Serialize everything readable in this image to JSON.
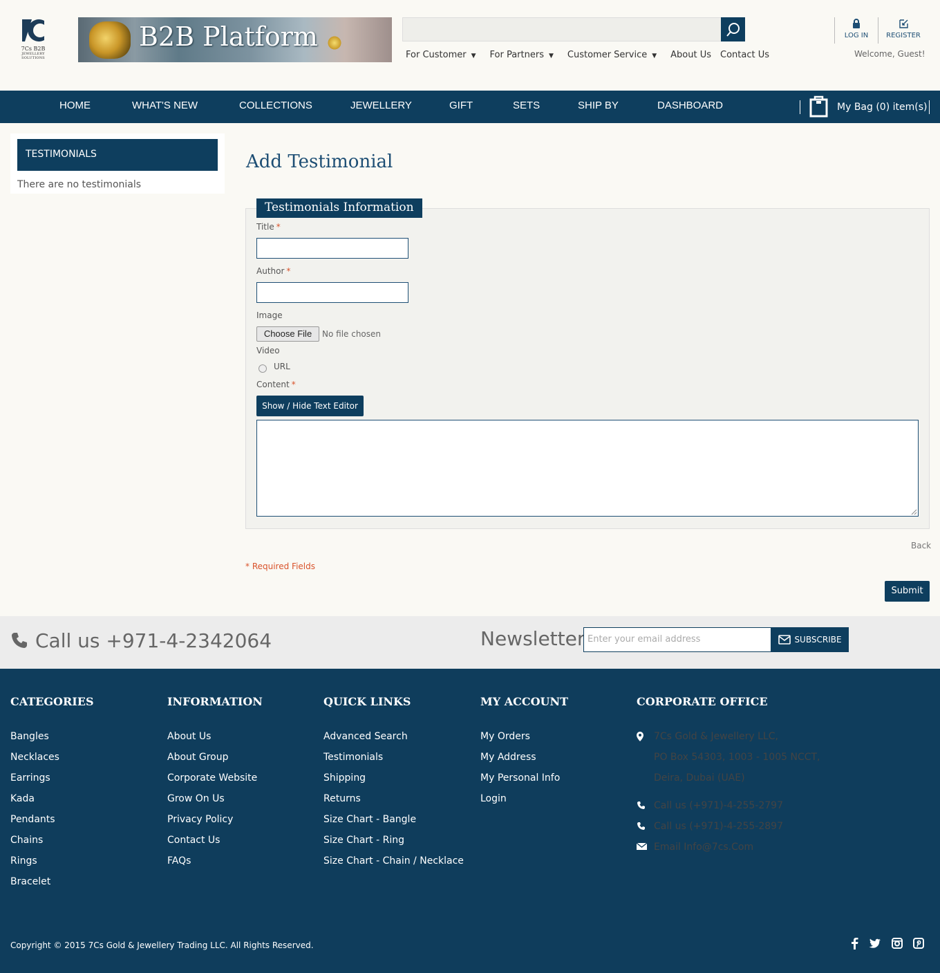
{
  "brand": {
    "logo_line1": "7Cs B2B",
    "logo_line2": "JEWELLERY SOLUTIONS",
    "banner_title": "B2B Platform"
  },
  "colors": {
    "primary": "#0e3e5e",
    "footer": "#0f3d5c",
    "required": "#d9532b",
    "page_bg": "#faf9f4"
  },
  "search": {
    "placeholder": "",
    "icon": "search-icon"
  },
  "topnav": [
    {
      "label": "For Customer",
      "dropdown": true
    },
    {
      "label": "For Partners",
      "dropdown": true
    },
    {
      "label": "Customer Service",
      "dropdown": true
    },
    {
      "label": "About Us",
      "dropdown": false
    },
    {
      "label": "Contact Us",
      "dropdown": false
    }
  ],
  "account": {
    "login": "LOG IN",
    "register": "REGISTER",
    "welcome": "Welcome, Guest!"
  },
  "mainnav": {
    "items": [
      "HOME",
      "WHAT'S NEW",
      "COLLECTIONS",
      "JEWELLERY",
      "GIFT",
      "SETS",
      "SHIP BY",
      "DASHBOARD"
    ],
    "bag": "My Bag (0) item(s)"
  },
  "sidebar": {
    "title": "TESTIMONIALS",
    "empty": "There are no testimonials"
  },
  "form": {
    "page_title": "Add Testimonial",
    "legend": "Testimonials Information",
    "title_label": "Title",
    "author_label": "Author",
    "image_label": "Image",
    "choose_file": "Choose File",
    "no_file": "No file chosen",
    "video_label": "Video",
    "url_label": "URL",
    "content_label": "Content",
    "editor_toggle": "Show / Hide Text Editor",
    "required_mark": "*",
    "back": "Back",
    "required_note": "* Required Fields",
    "submit": "Submit"
  },
  "band": {
    "call": "Call us +971-4-2342064",
    "newsletter": "Newsletter",
    "email_placeholder": "Enter your email address",
    "subscribe": "SUBSCRIBE"
  },
  "footer": {
    "categories": {
      "title": "CATEGORIES",
      "links": [
        "Bangles",
        "Necklaces",
        "Earrings",
        "Kada",
        "Pendants",
        "Chains",
        "Rings",
        "Bracelet"
      ]
    },
    "information": {
      "title": "INFORMATION",
      "links": [
        "About Us",
        "About Group",
        "Corporate Website",
        "Grow On Us",
        "Privacy Policy",
        "Contact Us",
        "FAQs"
      ]
    },
    "quick_links": {
      "title": "QUICK LINKS",
      "links": [
        "Advanced Search",
        "Testimonials",
        "Shipping",
        "Returns",
        "Size Chart - Bangle",
        "Size Chart - Ring",
        "Size Chart - Chain / Necklace"
      ]
    },
    "my_account": {
      "title": "MY ACCOUNT",
      "links": [
        "My Orders",
        "My Address",
        "My Personal Info",
        "Login"
      ]
    },
    "corporate": {
      "title": "CORPORATE OFFICE",
      "address": [
        "7Cs Gold & Jewellery LLC,",
        "PO Box 54303, 1003 - 1005 NCCT,",
        "Deira, Dubai (UAE)"
      ],
      "phone1": "Call us (+971)-4-255-2797",
      "phone2": "Call us (+971)-4-255-2897",
      "email": "Email Info@7cs.Com"
    },
    "copyright": "Copyright © 2015 7Cs Gold & Jewellery Trading LLC. All Rights Reserved.",
    "social": [
      "facebook-icon",
      "twitter-icon",
      "instagram-icon",
      "pinterest-icon"
    ]
  }
}
